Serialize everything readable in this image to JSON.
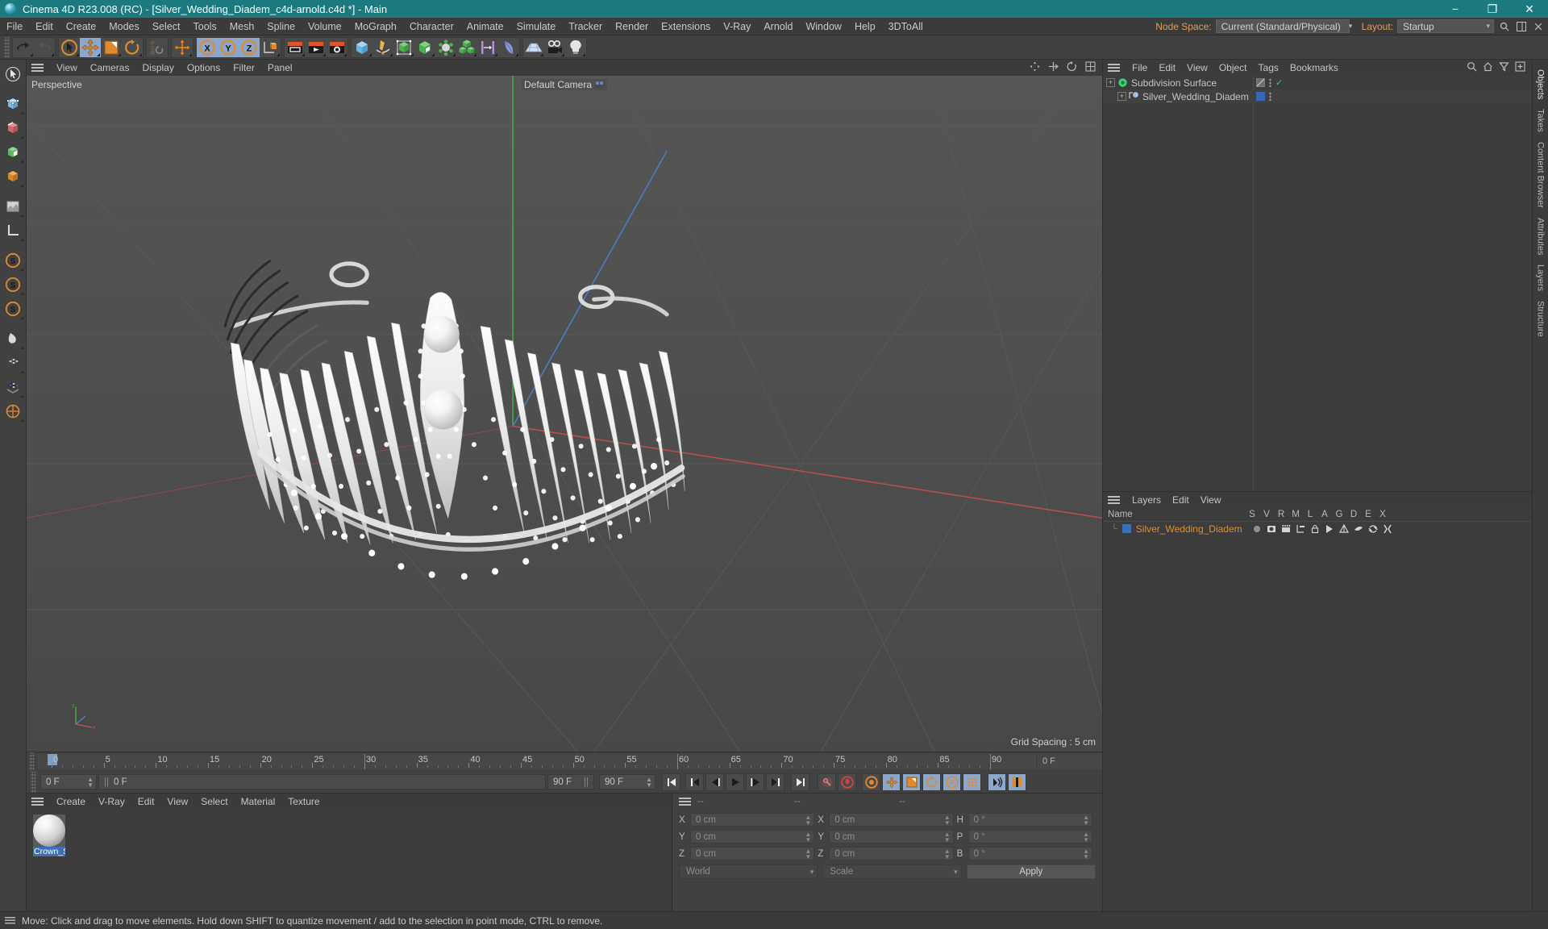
{
  "titlebar": {
    "title": "Cinema 4D R23.008 (RC) - [Silver_Wedding_Diadem_c4d-arnold.c4d *] - Main",
    "minimize": "−",
    "maximize": "❐",
    "close": "✕"
  },
  "menubar": {
    "items": [
      "File",
      "Edit",
      "Create",
      "Modes",
      "Select",
      "Tools",
      "Mesh",
      "Spline",
      "Volume",
      "MoGraph",
      "Character",
      "Animate",
      "Simulate",
      "Tracker",
      "Render",
      "Extensions",
      "V-Ray",
      "Arnold",
      "Window",
      "Help",
      "3DToAll"
    ],
    "node_space_label": "Node Space:",
    "node_space_value": "Current (Standard/Physical)",
    "layout_label": "Layout:",
    "layout_value": "Startup",
    "search_icon": "search-icon",
    "panel_icon": "panel-icon"
  },
  "toolbar": {
    "groups": [
      {
        "name": "history",
        "buttons": [
          {
            "name": "undo-button",
            "icon": "undo-arrow"
          },
          {
            "name": "redo-button",
            "icon": "redo-arrow"
          }
        ]
      },
      {
        "name": "transform",
        "buttons": [
          {
            "name": "select-tool",
            "icon": "cursor-circle"
          },
          {
            "name": "move-tool",
            "icon": "move-cross"
          },
          {
            "name": "scale-tool",
            "icon": "scale-box"
          },
          {
            "name": "rotate-tool",
            "icon": "rotate-arrow"
          }
        ]
      },
      {
        "name": "psr",
        "buttons": [
          {
            "name": "psr-toggle",
            "icon": "psr-letters"
          }
        ]
      },
      {
        "name": "world",
        "buttons": [
          {
            "name": "world-axis",
            "icon": "move-cross"
          }
        ]
      },
      {
        "name": "axis-locks",
        "buttons": [
          {
            "name": "lock-x-axis",
            "icon": "x-circle"
          },
          {
            "name": "lock-y-axis",
            "icon": "y-circle"
          },
          {
            "name": "lock-z-axis",
            "icon": "z-circle"
          },
          {
            "name": "object-world-toggle",
            "icon": "axis-cube"
          }
        ]
      },
      {
        "name": "render",
        "buttons": [
          {
            "name": "render-view",
            "icon": "clapper-view"
          },
          {
            "name": "render-to-picture-viewer",
            "icon": "clapper-play"
          },
          {
            "name": "render-settings",
            "icon": "clapper-gear"
          }
        ]
      },
      {
        "name": "create",
        "buttons": [
          {
            "name": "add-cube",
            "icon": "blue-cube"
          },
          {
            "name": "add-spline",
            "icon": "pen-spline"
          },
          {
            "name": "nurbs-generator",
            "icon": "green-cage"
          },
          {
            "name": "array-modeling",
            "icon": "green-cube"
          },
          {
            "name": "deformer",
            "icon": "green-atom"
          },
          {
            "name": "mograph-cloner",
            "icon": "green-cubes"
          },
          {
            "name": "scene-nodes",
            "icon": "purple-bars"
          },
          {
            "name": "field-object",
            "icon": "blue-blob"
          }
        ]
      },
      {
        "name": "scene",
        "buttons": [
          {
            "name": "add-floor",
            "icon": "grid-plane"
          },
          {
            "name": "add-camera",
            "icon": "camera-icon"
          },
          {
            "name": "add-light",
            "icon": "light-bulb"
          }
        ]
      }
    ]
  },
  "leftbar": {
    "buttons": [
      {
        "name": "live-selection-tool",
        "icon": "arrow-cursor"
      },
      {
        "name": "point-mode",
        "icon": "cube-point"
      },
      {
        "name": "edge-mode",
        "icon": "cube-edge"
      },
      {
        "name": "polygon-mode",
        "icon": "cube-poly"
      },
      {
        "name": "model-mode",
        "icon": "cube-model"
      },
      {
        "name": "texture-mode",
        "icon": "texture-square"
      },
      {
        "name": "axis-mode",
        "icon": "axis-l"
      },
      {
        "name": "enable-snap",
        "icon": "snap-s1"
      },
      {
        "name": "snap-settings",
        "icon": "snap-s2"
      },
      {
        "name": "workplane-snap",
        "icon": "snap-s3"
      },
      {
        "name": "viewport-solo",
        "icon": "drop-icon"
      },
      {
        "name": "viewport-display",
        "icon": "checker-icon"
      },
      {
        "name": "layer-color",
        "icon": "palette-icon"
      },
      {
        "name": "rotation-snap",
        "icon": "circle-snap"
      }
    ]
  },
  "viewport": {
    "menu": [
      "View",
      "Cameras",
      "Display",
      "Options",
      "Filter",
      "Panel"
    ],
    "label": "Perspective",
    "camera": "Default Camera",
    "grid_spacing": "Grid Spacing : 5 cm",
    "axis_y": "y",
    "axis_x": "x",
    "axis_z": "z"
  },
  "timeline": {
    "ticks": [
      0,
      5,
      10,
      15,
      20,
      25,
      30,
      35,
      40,
      45,
      50,
      55,
      60,
      65,
      70,
      75,
      80,
      85,
      90
    ],
    "range_start": 0,
    "range_end": 90,
    "current_frame": "0 F",
    "loop_start": "0 F",
    "end_frame_left": "90 F",
    "end_frame_field": "90 F",
    "preview_frame": "0 F",
    "transport": [
      {
        "name": "go-to-start-button",
        "icon": "skip-start"
      },
      {
        "name": "go-to-previous-key-button",
        "icon": "prev-key"
      },
      {
        "name": "go-to-previous-frame-button",
        "icon": "prev-frame"
      },
      {
        "name": "play-button",
        "icon": "play"
      },
      {
        "name": "go-to-next-frame-button",
        "icon": "next-frame"
      },
      {
        "name": "go-to-next-key-button",
        "icon": "next-key"
      },
      {
        "name": "go-to-end-button",
        "icon": "skip-end"
      },
      {
        "name": "record-active-objects-button",
        "icon": "key-record"
      },
      {
        "name": "autokeying-button",
        "icon": "auto-key"
      },
      {
        "name": "keyframe-selection-button",
        "icon": "key-select"
      },
      {
        "name": "record-position-button",
        "icon": "pos-cross"
      },
      {
        "name": "record-scale-button",
        "icon": "scale-rec"
      },
      {
        "name": "record-rotation-button",
        "icon": "rot-rec"
      },
      {
        "name": "record-pla-button",
        "icon": "pla-circle"
      },
      {
        "name": "record-param-button",
        "icon": "dot-grid"
      },
      {
        "name": "sound-button",
        "icon": "sound-wave"
      },
      {
        "name": "timeline-settings-button",
        "icon": "timeline-bars"
      }
    ]
  },
  "material_manager": {
    "menu": [
      "Create",
      "V-Ray",
      "Edit",
      "View",
      "Select",
      "Material",
      "Texture"
    ],
    "materials": [
      {
        "name": "Crown_S"
      }
    ]
  },
  "coordinates": {
    "headers": [
      "--",
      "--",
      "--"
    ],
    "rows": [
      {
        "pos_label": "X",
        "pos_value": "0 cm",
        "size_label": "X",
        "size_value": "0 cm",
        "rot_label": "H",
        "rot_value": "0 °"
      },
      {
        "pos_label": "Y",
        "pos_value": "0 cm",
        "size_label": "Y",
        "size_value": "0 cm",
        "rot_label": "P",
        "rot_value": "0 °"
      },
      {
        "pos_label": "Z",
        "pos_value": "0 cm",
        "size_label": "Z",
        "size_value": "0 cm",
        "rot_label": "B",
        "rot_value": "0 °"
      }
    ],
    "coord_system": "World",
    "mode": "Scale",
    "apply_label": "Apply"
  },
  "object_manager": {
    "menu": [
      "File",
      "Edit",
      "View",
      "Object",
      "Tags",
      "Bookmarks"
    ],
    "items": [
      {
        "name": "Subdivision Surface",
        "indent": 0,
        "tagtype": "deformer"
      },
      {
        "name": "Silver_Wedding_Diadem",
        "indent": 1,
        "tagtype": "mesh"
      }
    ]
  },
  "layer_manager": {
    "menu": [
      "Layers",
      "Edit",
      "View"
    ],
    "name_header": "Name",
    "columns": [
      "S",
      "V",
      "R",
      "M",
      "L",
      "A",
      "G",
      "D",
      "E",
      "X"
    ],
    "layers": [
      {
        "name": "Silver_Wedding_Diadem"
      }
    ]
  },
  "right_tabs": [
    "Objects",
    "Takes",
    "Content Browser",
    "Attributes",
    "Layers",
    "Structure"
  ],
  "statusbar": {
    "message": "Move: Click and drag to move elements. Hold down SHIFT to quantize movement / add to the selection in point mode, CTRL to remove."
  },
  "colors": {
    "title_bar": "#1c7a7e",
    "accent_orange": "#e08a2e",
    "selection_blue": "#8ba7cc",
    "layer_text": "#d98f3a",
    "panel_bg": "#414141",
    "viewport_bg": "#4c4c4c"
  }
}
